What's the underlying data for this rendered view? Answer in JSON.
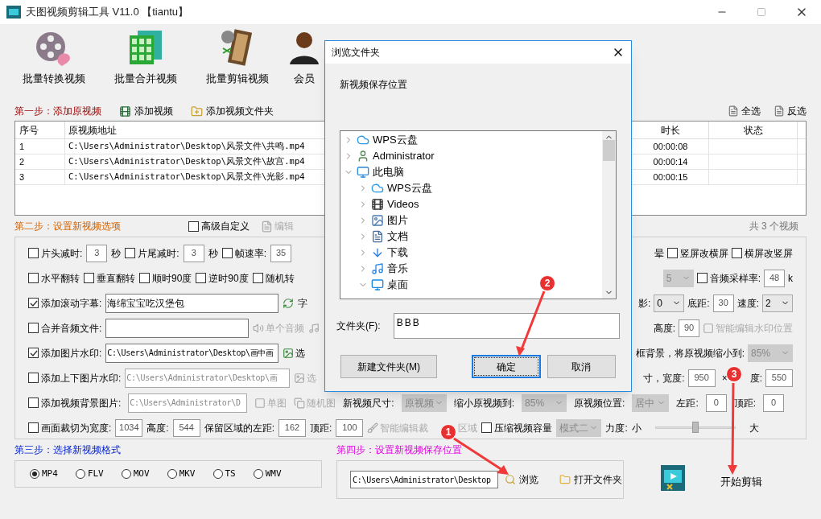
{
  "window": {
    "title": "天图视频剪辑工具 V11.0 【tiantu】"
  },
  "toolbar": [
    {
      "label": "批量转换视频",
      "kind": "reel"
    },
    {
      "label": "批量合并视频",
      "kind": "grid"
    },
    {
      "label": "批量剪辑视频",
      "kind": "strip"
    },
    {
      "label": "会员",
      "kind": "person"
    }
  ],
  "step1": {
    "title": "第一步：添加原视频",
    "buttons": [
      {
        "label": "添加视频",
        "kind": "film"
      },
      {
        "label": "添加视频文件夹",
        "kind": "folder"
      }
    ],
    "select_all": "全选",
    "invert": "反选"
  },
  "table": {
    "columns": [
      "序号",
      "原视频地址",
      "时长",
      "状态"
    ],
    "rows": [
      {
        "index": "1",
        "path": "C:\\Users\\Administrator\\Desktop\\风景文件\\共鸣.mp4",
        "duration": "00:00:08"
      },
      {
        "index": "2",
        "path": "C:\\Users\\Administrator\\Desktop\\风景文件\\故宫.mp4",
        "duration": "00:00:14"
      },
      {
        "index": "3",
        "path": "C:\\Users\\Administrator\\Desktop\\风景文件\\光影.mp4",
        "duration": "00:00:15"
      }
    ]
  },
  "step2": {
    "title": "第二步：设置新视频选项",
    "advanced": {
      "label": "高级自定义",
      "checked": false
    },
    "edit": "编辑",
    "count": "共 3 个视频"
  },
  "options": [
    {
      "left": [
        {
          "kind": "checkbox",
          "label": "片头减时:",
          "checked": false
        },
        {
          "kind": "num",
          "value": "3"
        },
        {
          "kind": "text",
          "text": "秒"
        },
        {
          "kind": "checkbox",
          "label": "片尾减时:",
          "checked": false
        },
        {
          "kind": "num",
          "value": "3"
        },
        {
          "kind": "text",
          "text": "秒"
        },
        {
          "kind": "checkbox",
          "label": "帧速率:",
          "checked": false
        },
        {
          "kind": "num",
          "value": "35"
        }
      ],
      "right": [
        {
          "kind": "text",
          "text": "晕"
        },
        {
          "kind": "checkbox",
          "label": "竖屏改横屏",
          "checked": false
        },
        {
          "kind": "checkbox",
          "label": "横屏改竖屏",
          "checked": false
        }
      ]
    },
    {
      "left": [
        {
          "kind": "checkbox",
          "label": "水平翻转",
          "checked": false
        },
        {
          "kind": "checkbox",
          "label": "垂直翻转",
          "checked": false
        },
        {
          "kind": "checkbox",
          "label": "顺时90度",
          "checked": false
        },
        {
          "kind": "checkbox",
          "label": "逆时90度",
          "checked": false
        },
        {
          "kind": "checkbox",
          "label": "随机转",
          "checked": false
        }
      ],
      "right": [
        {
          "kind": "select",
          "value": "5",
          "disabled": true
        },
        {
          "kind": "checkbox",
          "label": "音频采样率:",
          "checked": false
        },
        {
          "kind": "num",
          "value": "48"
        },
        {
          "kind": "text",
          "text": "k"
        }
      ]
    },
    {
      "left": [
        {
          "kind": "checkbox",
          "label": "添加滚动字幕:",
          "checked": true
        },
        {
          "kind": "caption",
          "value": "海绵宝宝吃汉堡包"
        },
        {
          "kind": "refresh",
          "disabled": false
        },
        {
          "kind": "text",
          "text": "字"
        }
      ],
      "right": [
        {
          "kind": "text",
          "text": "影:"
        },
        {
          "kind": "select",
          "value": "0",
          "disabled": false
        },
        {
          "kind": "text",
          "text": "底距:"
        },
        {
          "kind": "num",
          "value": "30"
        },
        {
          "kind": "text",
          "text": "速度:"
        },
        {
          "kind": "select",
          "value": "2",
          "disabled": false
        }
      ]
    },
    {
      "left": [
        {
          "kind": "checkbox",
          "label": "合并音频文件:",
          "checked": false
        },
        {
          "kind": "audio"
        },
        {
          "kind": "speaker",
          "label": "单个音频",
          "disabled": true
        },
        {
          "kind": "music",
          "disabled": true
        }
      ],
      "right": [
        {
          "kind": "text",
          "text": "高度:"
        },
        {
          "kind": "num",
          "value": "90"
        },
        {
          "kind": "watermark",
          "label": "智能编辑水印位置",
          "disabled": true
        }
      ]
    },
    {
      "left": [
        {
          "kind": "checkbox",
          "label": "添加图片水印:",
          "checked": true
        },
        {
          "kind": "pathwide",
          "value": "C:\\Users\\Administrator\\Desktop\\画中画"
        },
        {
          "kind": "imagepick",
          "label": "选",
          "disabled": false
        }
      ],
      "right": [
        {
          "kind": "text",
          "text": "框背景，将原视频缩小到:"
        },
        {
          "kind": "select",
          "value": "85%",
          "disabled": true
        }
      ]
    },
    {
      "left": [
        {
          "kind": "checkbox",
          "label": "添加上下图片水印:",
          "checked": false
        },
        {
          "kind": "path",
          "value": "C:\\Users\\Administrator\\Desktop\\画",
          "disabled": true
        },
        {
          "kind": "imagepick",
          "label": "选",
          "disabled": true
        }
      ],
      "right": [
        {
          "kind": "text",
          "text": "寸，宽度:"
        },
        {
          "kind": "num",
          "value": "950"
        },
        {
          "kind": "sign",
          "text": "×"
        },
        {
          "kind": "text",
          "text": "度:"
        },
        {
          "kind": "num",
          "value": "550"
        }
      ]
    },
    {
      "items": [
        {
          "kind": "checkbox",
          "label": "添加视频背景图片:",
          "checked": false
        },
        {
          "kind": "short",
          "value": "C:\\Users\\Administrator\\D",
          "disabled": true
        },
        {
          "kind": "single",
          "label": "单图",
          "disabled": true
        },
        {
          "kind": "random",
          "label": "随机图",
          "disabled": true
        },
        {
          "kind": "text",
          "text": "新视频尺寸:"
        },
        {
          "kind": "select",
          "value": "原视频",
          "disabled": true
        },
        {
          "kind": "text",
          "text": "缩小原视频到:"
        },
        {
          "kind": "select",
          "value": "85%",
          "disabled": true
        },
        {
          "kind": "text",
          "text": "原视频位置:"
        },
        {
          "kind": "select",
          "value": "居中",
          "disabled": true
        },
        {
          "kind": "text",
          "text": "左距:"
        },
        {
          "kind": "num",
          "value": "0"
        },
        {
          "kind": "text",
          "text": "顶距:"
        },
        {
          "kind": "num",
          "value": "0"
        }
      ]
    },
    {
      "items": [
        {
          "kind": "checkbox",
          "label": "画面裁切为宽度:",
          "checked": false
        },
        {
          "kind": "num",
          "value": "1034"
        },
        {
          "kind": "text",
          "text": "高度:"
        },
        {
          "kind": "num",
          "value": "544"
        },
        {
          "kind": "text",
          "text": "保留区域的左距:"
        },
        {
          "kind": "num",
          "value": "162"
        },
        {
          "kind": "text",
          "text": "顶距:"
        },
        {
          "kind": "num",
          "value": "100"
        },
        {
          "kind": "brush",
          "label": "智能编辑裁",
          "disabled": true
        },
        {
          "kind": "after",
          "text": "区域"
        },
        {
          "kind": "checkbox",
          "label": "压缩视频容量",
          "checked": false
        },
        {
          "kind": "select",
          "value": "模式二",
          "disabled": true
        },
        {
          "kind": "text",
          "text": "力度:"
        },
        {
          "kind": "text",
          "text": "小"
        },
        {
          "kind": "slider",
          "level": 0.5
        },
        {
          "kind": "text",
          "text": "大"
        }
      ]
    }
  ],
  "step3": {
    "title": "第三步：选择新视频格式",
    "formats": [
      {
        "label": "MP4",
        "selected": true
      },
      {
        "label": "FLV",
        "selected": false
      },
      {
        "label": "MOV",
        "selected": false
      },
      {
        "label": "MKV",
        "selected": false
      },
      {
        "label": "TS",
        "selected": false
      },
      {
        "label": "WMV",
        "selected": false
      }
    ]
  },
  "step4": {
    "title": "第四步：设置新视频保存位置",
    "path": "C:\\Users\\Administrator\\Desktop",
    "browse": "浏览",
    "open_folder": "打开文件夹",
    "start": "开始剪辑"
  },
  "dialog": {
    "title": "浏览文件夹",
    "prompt": "新视频保存位置",
    "tree": [
      {
        "label": "WPS云盘",
        "kind": "cloud",
        "expanded": false
      },
      {
        "label": "Administrator",
        "kind": "user",
        "expanded": false
      },
      {
        "label": "此电脑",
        "kind": "pc",
        "expanded": true,
        "children": [
          {
            "label": "WPS云盘",
            "kind": "cloud",
            "expanded": false
          },
          {
            "label": "Videos",
            "kind": "film",
            "expanded": false
          },
          {
            "label": "图片",
            "kind": "image",
            "expanded": false
          },
          {
            "label": "文档",
            "kind": "doc",
            "expanded": false
          },
          {
            "label": "下载",
            "kind": "download",
            "expanded": false
          },
          {
            "label": "音乐",
            "kind": "music",
            "expanded": false
          },
          {
            "label": "桌面",
            "kind": "desktop",
            "expanded": true
          }
        ]
      }
    ],
    "folder_label": "文件夹(F):",
    "folder_value": "BBB",
    "buttons": [
      {
        "label": "新建文件夹(M)",
        "default": false
      },
      {
        "label": "确定",
        "default": true
      },
      {
        "label": "取消",
        "default": false
      }
    ]
  },
  "annotations": [
    {
      "label": "1"
    },
    {
      "label": "2"
    },
    {
      "label": "3"
    }
  ]
}
